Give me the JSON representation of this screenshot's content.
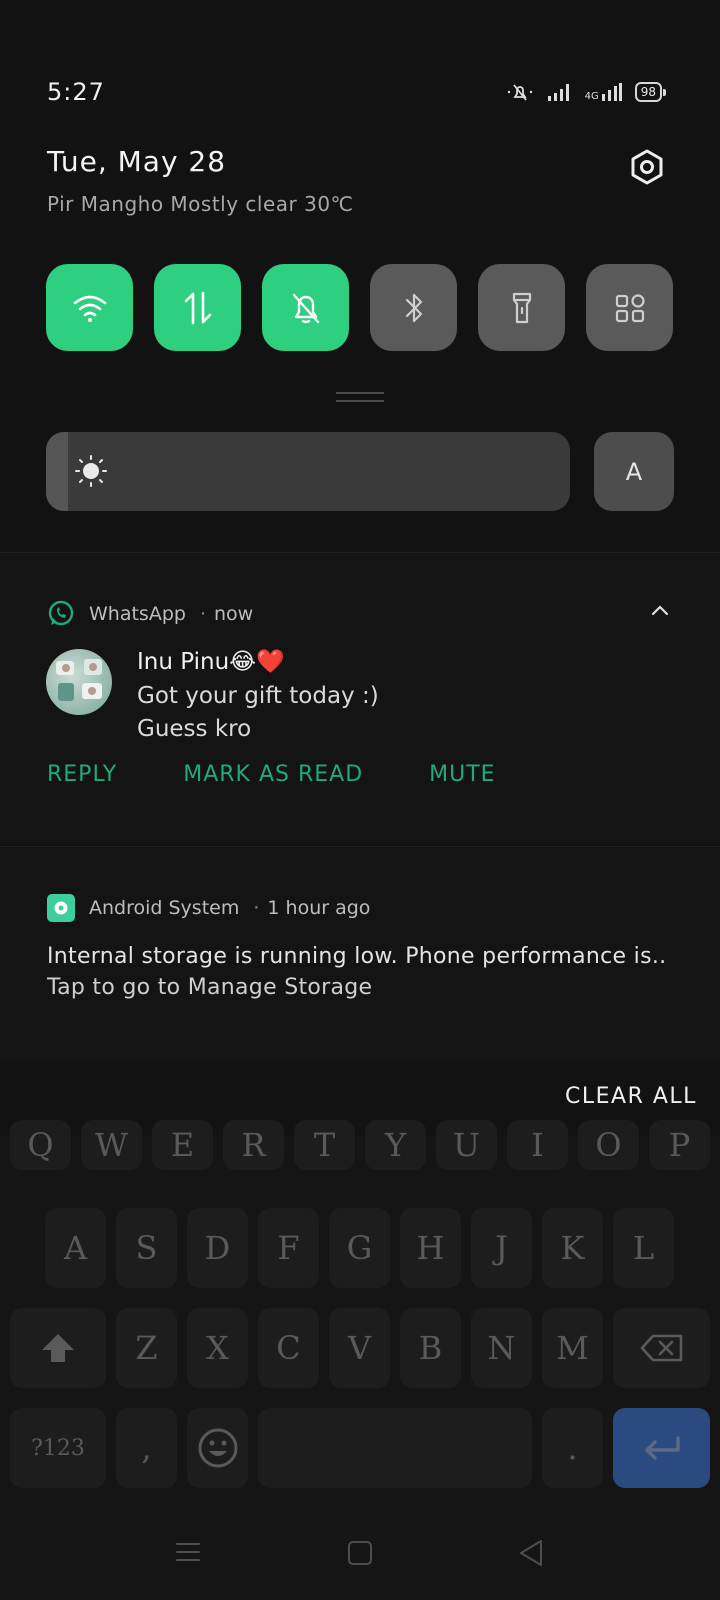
{
  "status_bar": {
    "time": "5:27",
    "network": "4G",
    "battery": "98",
    "icons": [
      "mute-icon",
      "signal-icon",
      "data-signal-icon",
      "battery-icon"
    ]
  },
  "header": {
    "date": "Tue, May 28",
    "weather": "Pir Mangho Mostly clear 30℃",
    "settings_icon": "gear-icon"
  },
  "quick_tiles": [
    {
      "name": "wifi",
      "icon": "wifi-icon",
      "active": true
    },
    {
      "name": "mobile-data",
      "icon": "data-arrows-icon",
      "active": true
    },
    {
      "name": "mute",
      "icon": "bell-off-icon",
      "active": true
    },
    {
      "name": "bluetooth",
      "icon": "bluetooth-icon",
      "active": false
    },
    {
      "name": "flashlight",
      "icon": "flashlight-icon",
      "active": false
    },
    {
      "name": "edit-tiles",
      "icon": "grid-icon",
      "active": false
    }
  ],
  "brightness": {
    "icon": "sun-icon",
    "auto_label": "A"
  },
  "whatsapp": {
    "app_name": "WhatsApp",
    "time": "now",
    "sender": "Inu Pinu😂❤️",
    "lines": [
      "Got your gift today :)",
      "Guess kro"
    ],
    "actions": {
      "reply": "REPLY",
      "mark_read": "MARK AS READ",
      "mute": "MUTE"
    }
  },
  "system": {
    "app_name": "Android System",
    "time": "1 hour ago",
    "line1": "Internal storage is running low. Phone performance is..",
    "line2": "Tap to go to Manage Storage"
  },
  "clear_all": "CLEAR ALL",
  "keyboard": {
    "row1": [
      "Q",
      "W",
      "E",
      "R",
      "T",
      "Y",
      "U",
      "I",
      "O",
      "P"
    ],
    "row2": [
      "A",
      "S",
      "D",
      "F",
      "G",
      "H",
      "J",
      "K",
      "L"
    ],
    "row3": [
      "Z",
      "X",
      "C",
      "V",
      "B",
      "N",
      "M"
    ],
    "symbols": "?123",
    "comma": ",",
    "period": ".",
    "accent": "#2b4a80"
  },
  "colors": {
    "tile_on": "#2ecf7f",
    "tile_off": "#5a5a5a",
    "action_text": "#1fa97c"
  }
}
